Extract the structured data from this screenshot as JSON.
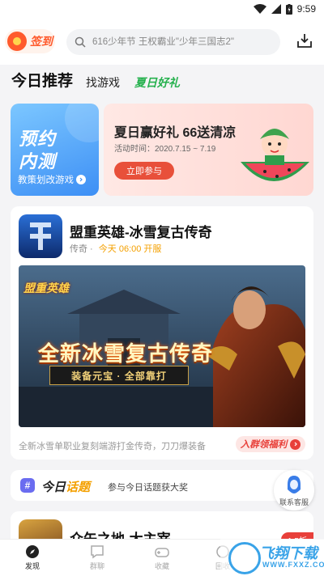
{
  "status_bar": {
    "time": "9:59"
  },
  "top_bar": {
    "checkin_label": "签到",
    "search_placeholder": "616少年节 王权霸业\"少年三国志2\""
  },
  "tabs": {
    "today": "今日推荐",
    "find": "找游戏",
    "summer": "夏日好礼"
  },
  "promo_blue": {
    "line1": "预约",
    "line2": "内测",
    "sub": "教策划改游戏"
  },
  "promo_pink": {
    "title": "夏日赢好礼 66送清凉",
    "date": "活动时间：2020.7.15 ~ 7.19",
    "button": "立即参与"
  },
  "featured_game": {
    "title": "盟重英雄-冰雪复古传奇",
    "platform": "传奇",
    "open_time": "今天 06:00 开服",
    "banner_main": "全新冰雪复古传奇",
    "banner_sub": "装备元宝 · 全部靠打",
    "banner_logo": "盟重英雄",
    "description": "全新冰雪单职业复刻端游打金传奇，刀刀爆装备",
    "welfare_button": "入群领福利"
  },
  "topic": {
    "title_a": "今日",
    "title_b": "话题",
    "subtitle": "参与今日话题获大奖"
  },
  "customer_service": {
    "label": "联系客服"
  },
  "next_game": {
    "title": "众矢之地-大主宰",
    "tag": "1.5折"
  },
  "bottom_nav": {
    "items": [
      {
        "label": "发现"
      },
      {
        "label": "群聊"
      },
      {
        "label": "收藏"
      },
      {
        "label": "回收"
      }
    ]
  },
  "watermark": {
    "text": "飞翔下载",
    "url": "WWW.FXXZ.COM"
  },
  "colors": {
    "accent_green": "#26b14e",
    "accent_orange": "#f4a000",
    "accent_red": "#e8403a",
    "promo_blue": "#3d8ff5"
  }
}
